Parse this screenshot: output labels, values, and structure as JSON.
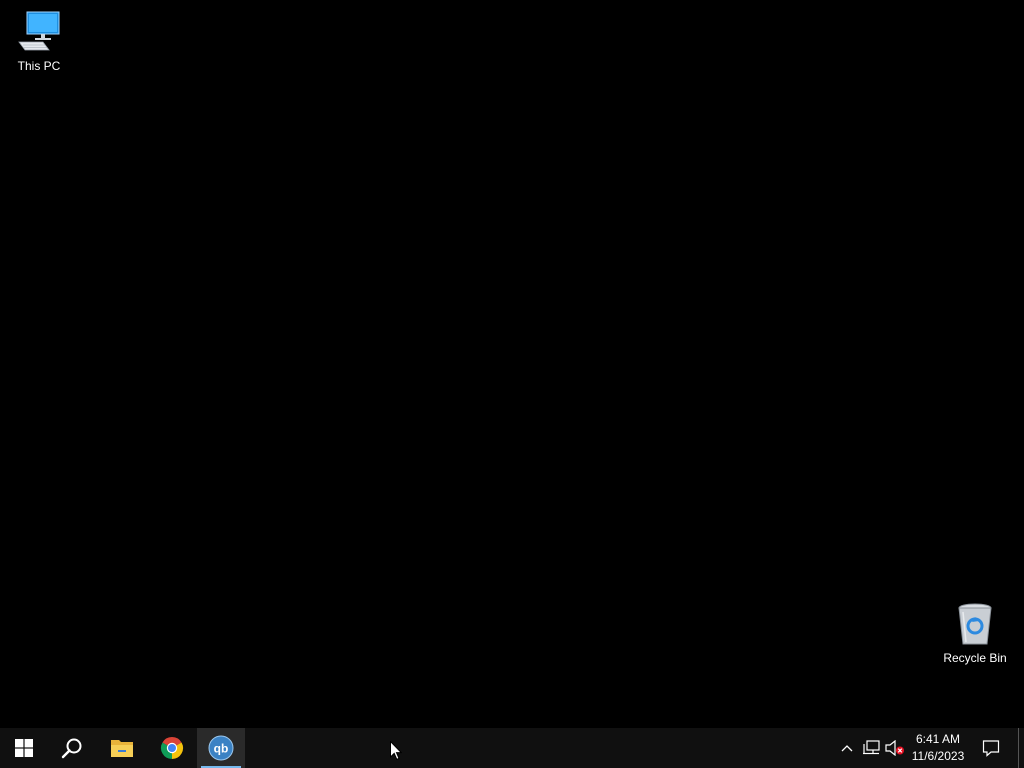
{
  "desktop": {
    "icons": [
      {
        "label": "This PC",
        "icon": "this-pc-icon"
      },
      {
        "label": "Recycle Bin",
        "icon": "recycle-bin-icon"
      }
    ]
  },
  "taskbar": {
    "pinned": [
      {
        "icon": "windows-start-icon"
      },
      {
        "icon": "search-icon"
      },
      {
        "icon": "file-explorer-icon"
      },
      {
        "icon": "chrome-icon"
      },
      {
        "icon": "qbittorrent-icon",
        "text": "qb",
        "active": true
      }
    ],
    "tray": {
      "icons": [
        "chevron-up-icon",
        "network-icon",
        "volume-muted-icon",
        "notification-icon"
      ],
      "time": "6:41 AM",
      "date": "11/6/2023"
    }
  },
  "colors": {
    "desktop_bg": "#000000",
    "taskbar_bg": "#101010",
    "active_indicator": "#76b9ed",
    "qb_blue": "#3b82c4"
  }
}
